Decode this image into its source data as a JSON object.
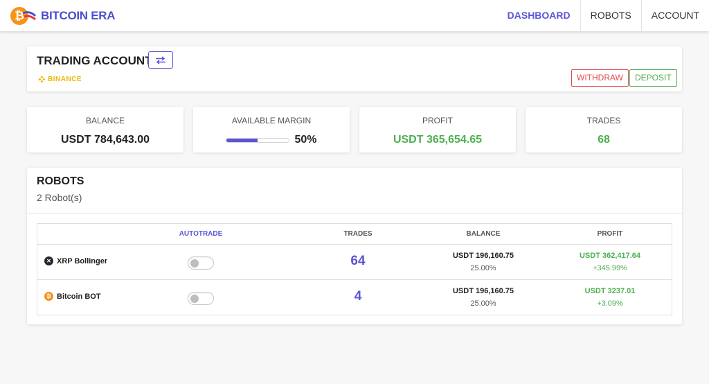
{
  "brand": {
    "name": "BITCOIN ERA",
    "coin_glyph": "₿",
    "colors": {
      "primary": "#5b55d6",
      "bitcoin": "#f7931a",
      "green": "#4caf50",
      "red": "#e04b4b",
      "binance": "#f0b90b"
    }
  },
  "nav": {
    "items": [
      {
        "label": "DASHBOARD",
        "active": true
      },
      {
        "label": "ROBOTS",
        "active": false
      },
      {
        "label": "ACCOUNT",
        "active": false
      }
    ]
  },
  "trading_account": {
    "title": "TRADING ACCOUNT",
    "swap_icon": "swap-arrows-icon",
    "exchange": "BINANCE",
    "withdraw_label": "WITHDRAW",
    "deposit_label": "DEPOSIT"
  },
  "stats": {
    "balance": {
      "label": "BALANCE",
      "value": "USDT 784,643.00"
    },
    "margin": {
      "label": "AVAILABLE MARGIN",
      "value": "50%",
      "fraction": 0.5
    },
    "profit": {
      "label": "PROFIT",
      "value": "USDT 365,654.65"
    },
    "trades": {
      "label": "TRADES",
      "value": "68"
    }
  },
  "robots": {
    "title": "ROBOTS",
    "count": "2 Robot(s)",
    "headers": {
      "autotrade": "AUTOTRADE",
      "trades": "TRADES",
      "balance": "BALANCE",
      "profit": "PROFIT"
    },
    "rows": [
      {
        "name": "XRP Bollinger",
        "icon": "xrp-icon",
        "autotrade": false,
        "trades": "64",
        "balance": "USDT 196,160.75",
        "balance_pct": "25.00%",
        "profit": "USDT 362,417.64",
        "profit_pct": "+345.99%"
      },
      {
        "name": "Bitcoin BOT",
        "icon": "bitcoin-icon",
        "autotrade": false,
        "trades": "4",
        "balance": "USDT 196,160.75",
        "balance_pct": "25.00%",
        "profit": "USDT 3237.01",
        "profit_pct": "+3.09%"
      }
    ]
  }
}
